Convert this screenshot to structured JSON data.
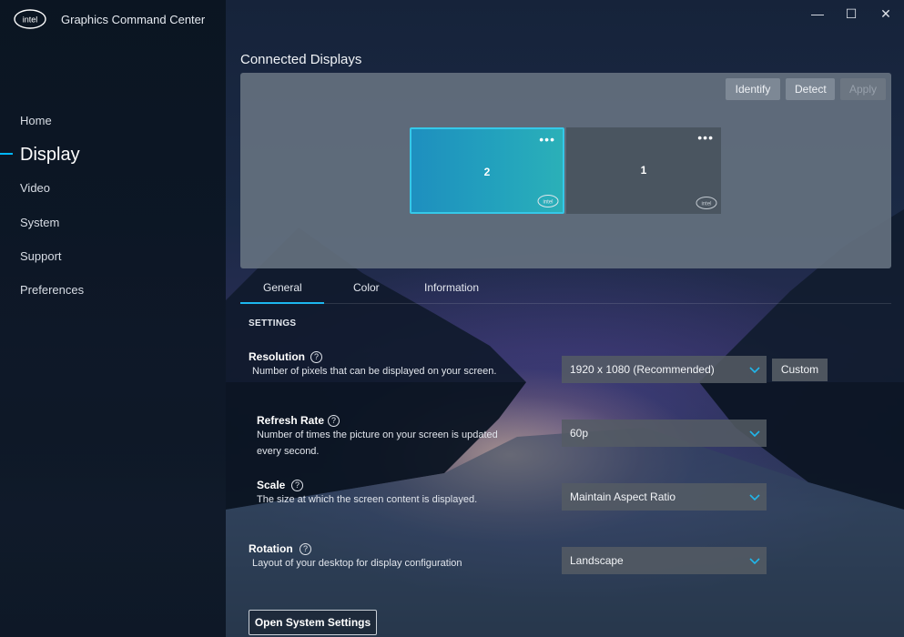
{
  "app": {
    "title": "Graphics Command Center",
    "logo_text": "intel"
  },
  "window_controls": {
    "minimize": "—",
    "maximize": "☐",
    "close": "✕"
  },
  "sidebar": {
    "items": [
      {
        "label": "Home"
      },
      {
        "label": "Display"
      },
      {
        "label": "Video"
      },
      {
        "label": "System"
      },
      {
        "label": "Support"
      },
      {
        "label": "Preferences"
      }
    ],
    "active": "Display"
  },
  "main": {
    "section_title": "Connected Displays",
    "panel_buttons": {
      "identify": "Identify",
      "detect": "Detect",
      "apply": "Apply"
    },
    "monitors": [
      {
        "number": "2",
        "selected": true,
        "menu": "•••",
        "brand": "intel"
      },
      {
        "number": "1",
        "selected": false,
        "menu": "•••",
        "brand": "intel"
      }
    ],
    "tabs": [
      {
        "label": "General"
      },
      {
        "label": "Color"
      },
      {
        "label": "Information"
      }
    ],
    "active_tab": "General",
    "settings_heading": "SETTINGS",
    "settings": {
      "resolution": {
        "label": "Resolution",
        "description": "Number of pixels that can be displayed on your screen.",
        "value": "1920 x 1080 (Recommended)",
        "custom_button": "Custom"
      },
      "refresh_rate": {
        "label": "Refresh Rate",
        "description_line1": "Number of times the picture on your screen is updated",
        "description_line2": "every second.",
        "value": "60p"
      },
      "scale": {
        "label": "Scale",
        "description": "The size at which the screen content is displayed.",
        "value": "Maintain Aspect Ratio"
      },
      "rotation": {
        "label": "Rotation",
        "description": "Layout of your desktop for display configuration",
        "value": "Landscape"
      }
    },
    "open_system_settings": "Open System Settings",
    "help_glyph": "?"
  },
  "colors": {
    "accent": "#1db7ef",
    "panel": "#687482",
    "selected_monitor": "#23a3bd"
  }
}
